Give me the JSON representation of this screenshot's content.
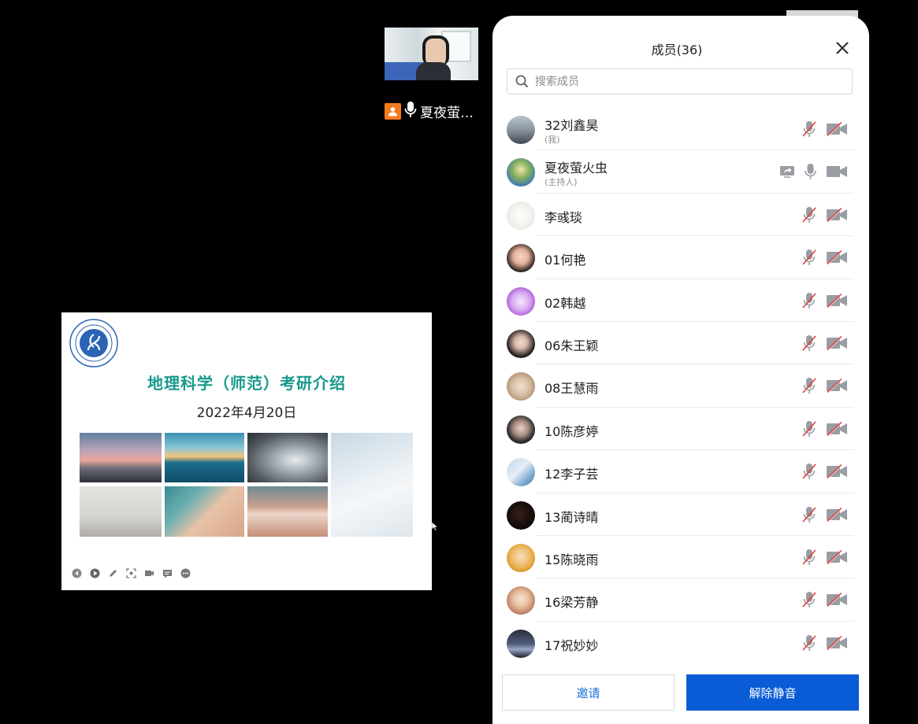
{
  "video_tile": {
    "participant_name": "夏夜萤…"
  },
  "slide": {
    "title": "地理科学（师范）考研介绍",
    "date": "2022年4月20日",
    "toolbar_icons": [
      "prev-icon",
      "play-icon",
      "pen-icon",
      "screenshot-icon",
      "camera-icon",
      "comment-icon",
      "more-icon"
    ]
  },
  "panel": {
    "title": "成员(36)",
    "search_placeholder": "搜索成员",
    "invite_label": "邀请",
    "unmute_all_label": "解除静音",
    "colors": {
      "accent": "#0a5cd6",
      "muted_red": "#e23c3c",
      "title_teal": "#18998c"
    }
  },
  "members": [
    {
      "name": "32刘鑫昊",
      "role": "(我)",
      "mic_muted": true,
      "cam_off": true,
      "sharing": false
    },
    {
      "name": "夏夜萤火虫",
      "role": "(主持人)",
      "mic_muted": false,
      "cam_off": false,
      "sharing": true
    },
    {
      "name": " 李彧琰",
      "role": "",
      "mic_muted": true,
      "cam_off": true,
      "sharing": false
    },
    {
      "name": "01何艳",
      "role": "",
      "mic_muted": true,
      "cam_off": true,
      "sharing": false
    },
    {
      "name": "02韩越",
      "role": "",
      "mic_muted": true,
      "cam_off": true,
      "sharing": false
    },
    {
      "name": "06朱王颖",
      "role": "",
      "mic_muted": true,
      "cam_off": true,
      "sharing": false
    },
    {
      "name": "08王慧雨",
      "role": "",
      "mic_muted": true,
      "cam_off": true,
      "sharing": false
    },
    {
      "name": "10陈彦婷",
      "role": "",
      "mic_muted": true,
      "cam_off": true,
      "sharing": false
    },
    {
      "name": "12李子芸",
      "role": "",
      "mic_muted": true,
      "cam_off": true,
      "sharing": false
    },
    {
      "name": "13蔺诗晴",
      "role": "",
      "mic_muted": true,
      "cam_off": true,
      "sharing": false
    },
    {
      "name": "15陈晓雨",
      "role": "",
      "mic_muted": true,
      "cam_off": true,
      "sharing": false
    },
    {
      "name": "16梁芳静",
      "role": "",
      "mic_muted": true,
      "cam_off": true,
      "sharing": false
    },
    {
      "name": "17祝妙妙",
      "role": "",
      "mic_muted": true,
      "cam_off": true,
      "sharing": false
    }
  ]
}
